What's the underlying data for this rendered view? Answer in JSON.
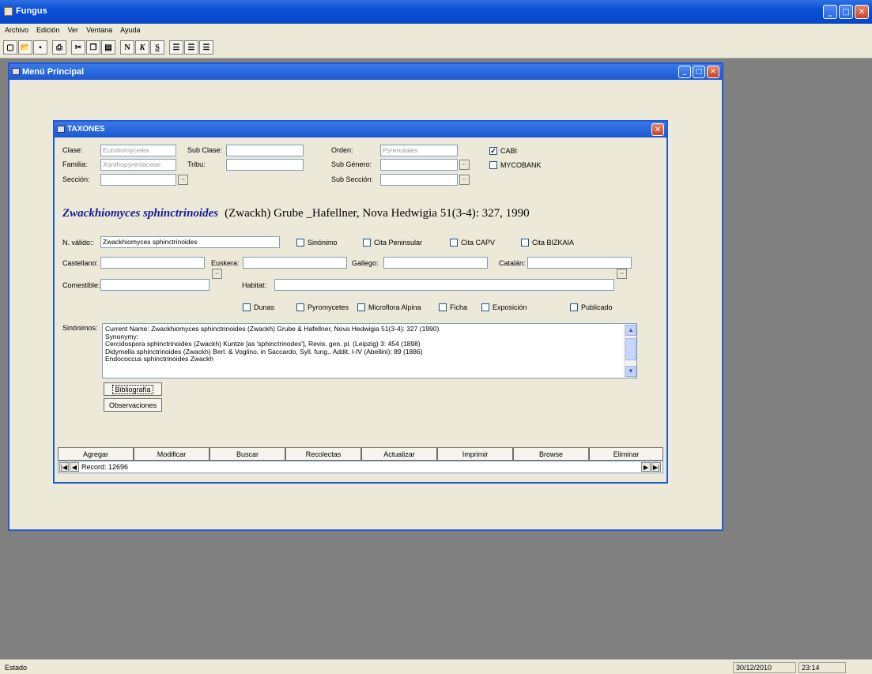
{
  "app": {
    "title": "Fungus"
  },
  "menu": [
    "Archivo",
    "Edición",
    "Ver",
    "Ventana",
    "Ayuda"
  ],
  "toolbar": {
    "bold": "N",
    "italic": "K",
    "underline": "S"
  },
  "child": {
    "title": "Menú Principal"
  },
  "dialog": {
    "title": "TAXONES",
    "fields": {
      "clase_label": "Clase:",
      "clase_value": "Eurotiomycetes",
      "subclase_label": "Sub Clase:",
      "subclase_value": "",
      "orden_label": "Orden:",
      "orden_value": "Pyrenulales",
      "familia_label": "Familia:",
      "familia_value": "Xanthopyreniaceae",
      "tribu_label": "Tribu:",
      "tribu_value": "",
      "subgenero_label": "Sub Género:",
      "subgenero_value": "",
      "seccion_label": "Sección:",
      "seccion_value": "",
      "subseccion_label": "Sub Sección:",
      "subseccion_value": ""
    },
    "sources": {
      "cabi": "CABI",
      "mycobank": "MYCOBANK"
    },
    "species": {
      "name": "Zwackhiomyces sphinctrinoides",
      "authority": "(Zwackh) Grube _Hafellner, Nova Hedwigia 51(3-4): 327, 1990"
    },
    "valid": {
      "label": "N. válido::",
      "value": "Zwackhiomyces sphinctrinoides"
    },
    "flags1": {
      "sinonimo": "Sinónimo",
      "cita_peninsular": "Cita Peninsular",
      "cita_capv": "Cita CAPV",
      "cita_bizkaia": "Cita BIZKAIA"
    },
    "names": {
      "castellano": "Castellano:",
      "euskera": "Euskera:",
      "gallego": "Gallego:",
      "catalan": "Catalán:",
      "comestible": "Comestible:",
      "habitat": "Habitat:"
    },
    "flags2": {
      "dunas": "Dunas",
      "pyromycetes": "Pyromycetes",
      "microflora": "Microflora Alpina",
      "ficha": "Ficha",
      "exposicion": "Exposición",
      "publicado": "Publicado"
    },
    "synonyms_label": "Sinónimos:",
    "synonyms": [
      "Current Name: Zwackhiomyces sphinctrinoides (Zwackh) Grube & Hafellner, Nova Hedwigia 51(3-4): 327 (1990)",
      "Synonymy:",
      "Cercidospora sphinctrinoides (Zwackh) Kuntze [as 'sphinctrinodes'], Revis. gen. pl. (Leipzig) 3: 454 (1898)",
      "Didymella sphinctrinoides (Zwackh) Berl. & Voglino, in Saccardo, Syll. fung., Addit. I-IV (Abellini): 89 (1886)",
      "Endococcus sphinctrinoides Zwackh"
    ],
    "buttons": {
      "bibliografia": "Bibliografía",
      "observaciones": "Observaciones"
    },
    "actions": [
      "Agregar",
      "Modificar",
      "Buscar",
      "Recolectas",
      "Actualizar",
      "Imprimir",
      "Browse",
      "Eliminar"
    ],
    "record": "Record: 12696"
  },
  "status": {
    "label": "Estado",
    "date": "30/12/2010",
    "time": "23:14"
  }
}
